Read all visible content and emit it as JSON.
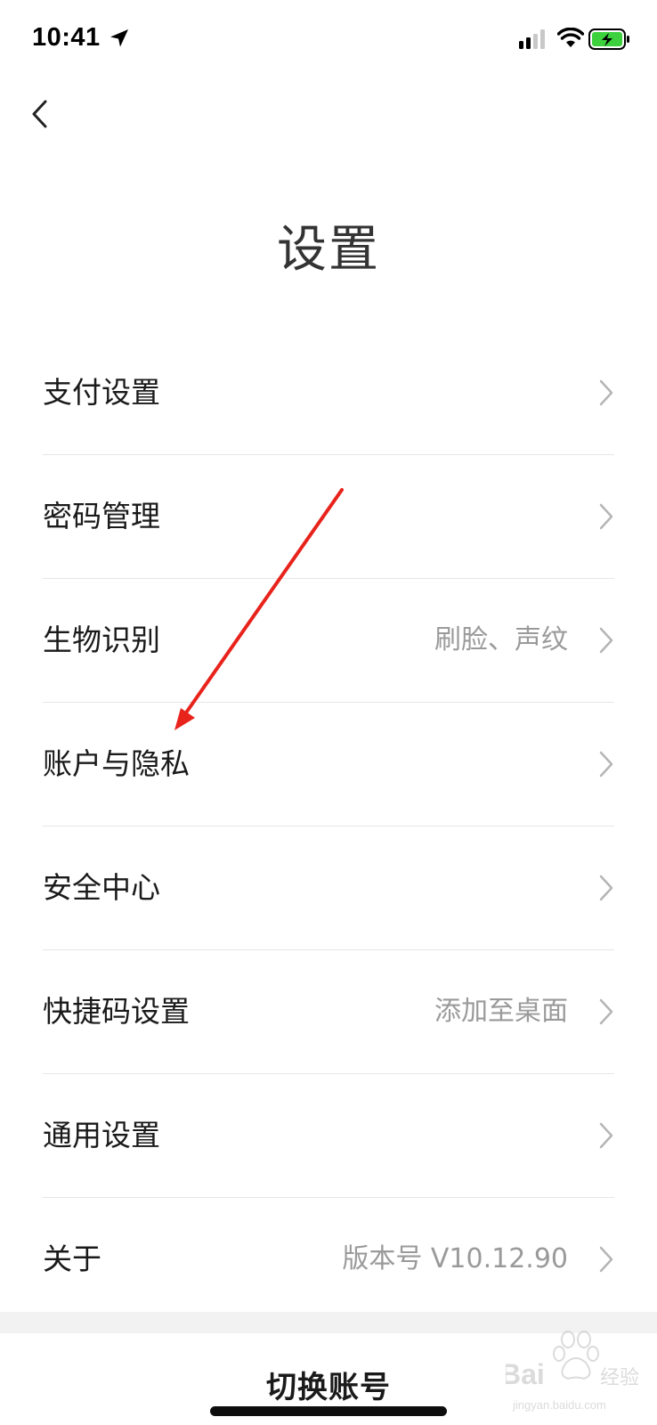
{
  "status_bar": {
    "time": "10:41",
    "icons": [
      "location-arrow-icon",
      "cellular-signal-icon",
      "wifi-icon",
      "battery-charging-icon"
    ],
    "battery_color": "#3dd13d"
  },
  "header": {
    "back_icon": "chevron-left-icon",
    "title": "设置"
  },
  "menu": {
    "items": [
      {
        "label": "支付设置",
        "value": ""
      },
      {
        "label": "密码管理",
        "value": ""
      },
      {
        "label": "生物识别",
        "value": "刷脸、声纹"
      },
      {
        "label": "账户与隐私",
        "value": ""
      },
      {
        "label": "安全中心",
        "value": ""
      },
      {
        "label": "快捷码设置",
        "value": "添加至桌面"
      },
      {
        "label": "通用设置",
        "value": ""
      },
      {
        "label": "关于",
        "value": "版本号 V10.12.90"
      }
    ]
  },
  "footer": {
    "switch_account": "切换账号"
  },
  "annotation": {
    "type": "arrow",
    "color": "#e8231c",
    "points_to": "账户与隐私"
  },
  "watermark": {
    "brand": "Bai du 经验",
    "url": "jingyan.baidu.com"
  }
}
